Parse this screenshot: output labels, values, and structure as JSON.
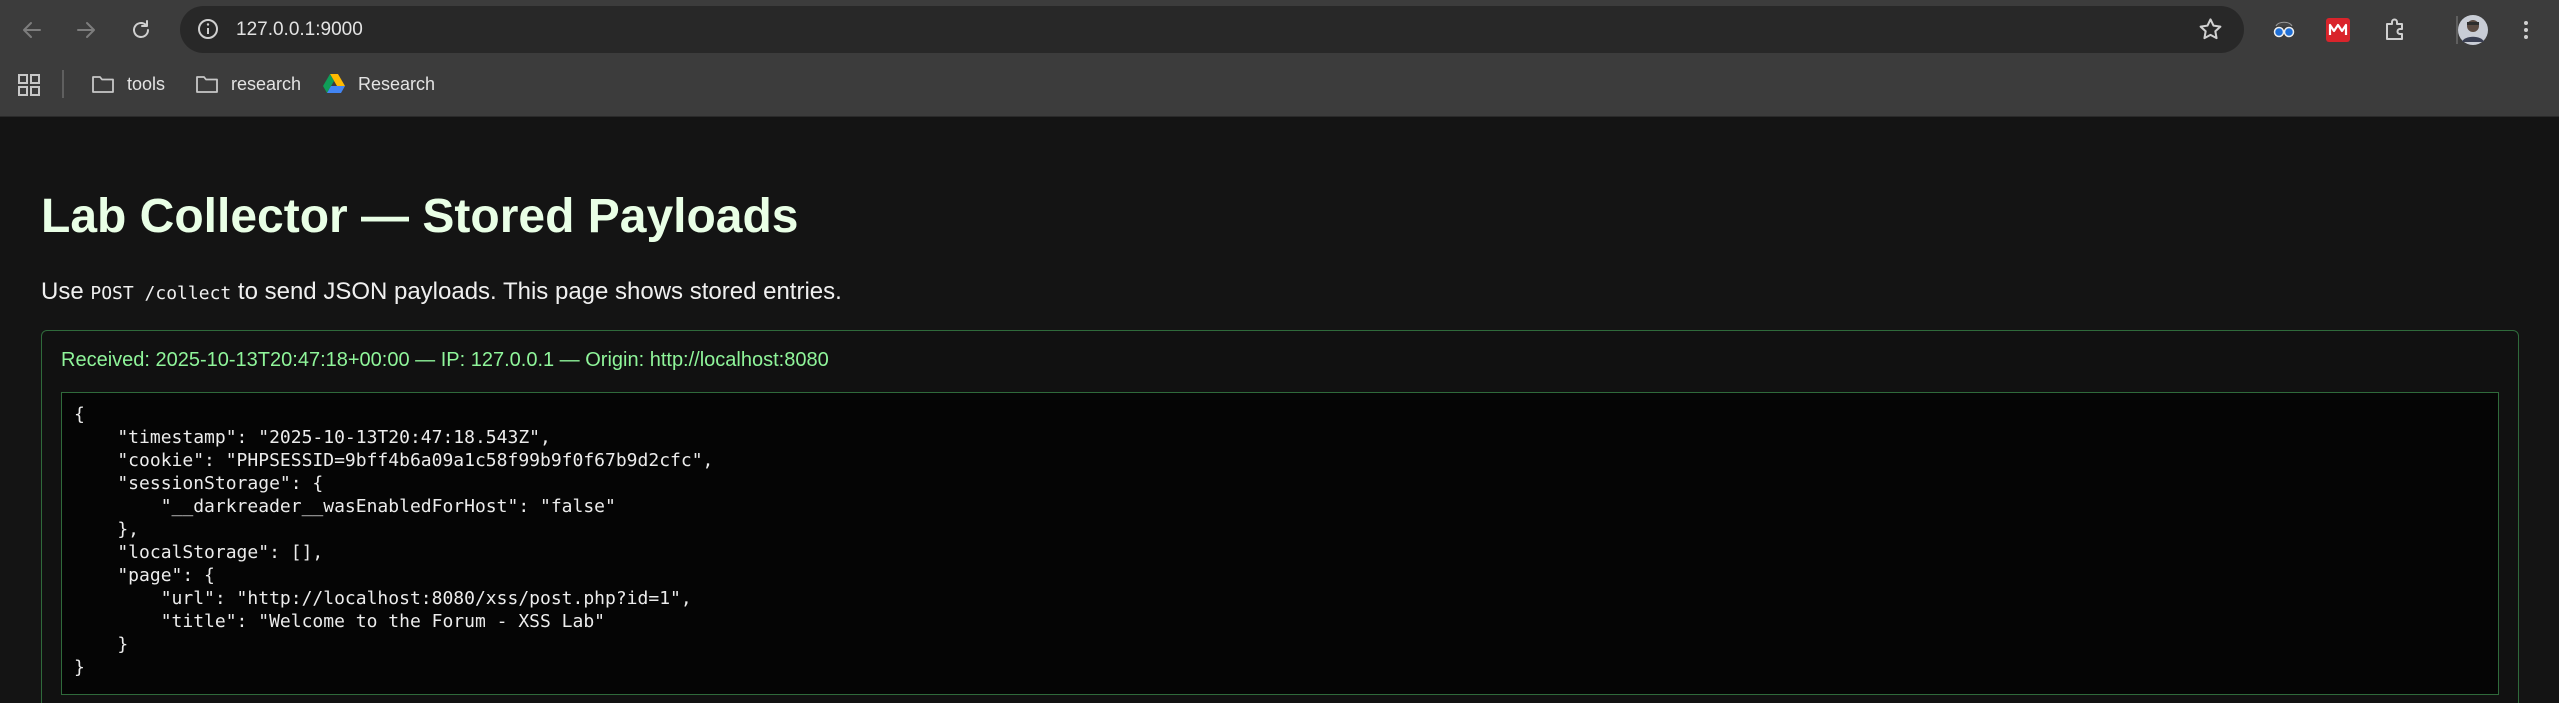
{
  "browser": {
    "url": "127.0.0.1:9000",
    "bookmarks": [
      {
        "label": "tools",
        "icon": "folder-icon"
      },
      {
        "label": "research",
        "icon": "folder-icon"
      },
      {
        "label": "Research",
        "icon": "google-drive-icon"
      }
    ],
    "icons": {
      "back": "arrow-left-icon",
      "forward": "arrow-right-icon",
      "reload": "reload-icon",
      "info": "info-icon",
      "bookmark": "star-icon",
      "apps": "apps-grid-icon",
      "extensions": "puzzle-icon",
      "menu": "kebab-menu-icon"
    }
  },
  "page": {
    "title": "Lab Collector — Stored Payloads",
    "intro_before": "Use ",
    "intro_code": "POST /collect",
    "intro_after": " to send JSON payloads. This page shows stored entries."
  },
  "entries": [
    {
      "meta": "Received: 2025-10-13T20:47:18+00:00 — IP: 127.0.0.1 — Origin: http://localhost:8080",
      "payload": "{\n    \"timestamp\": \"2025-10-13T20:47:18.543Z\",\n    \"cookie\": \"PHPSESSID=9bff4b6a09a1c58f99b9f0f67b9d2cfc\",\n    \"sessionStorage\": {\n        \"__darkreader__wasEnabledForHost\": \"false\"\n    },\n    \"localStorage\": [],\n    \"page\": {\n        \"url\": \"http://localhost:8080/xss/post.php?id=1\",\n        \"title\": \"Welcome to the Forum - XSS Lab\"\n    }\n}"
    }
  ],
  "colors": {
    "accent_green": "#8ff59a",
    "border_green": "#2f6a3b",
    "title": "#e9ffe6",
    "background": "#141414",
    "chrome": "#3c3c3c"
  }
}
